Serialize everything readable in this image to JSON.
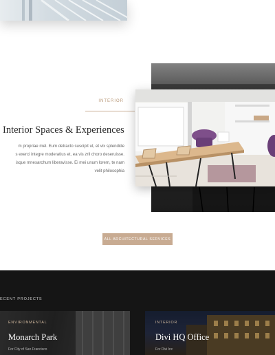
{
  "interior": {
    "eyebrow": "INTERIOR",
    "heading": "Interior Spaces & Experiences",
    "body_lines": [
      "m propriae mel. Eum detracto suscipit ut, et vix splendide",
      "s exerci integre moderatius et, ea vis zril choro deseruisse.",
      "isque mnesarchum liberavisse. Ei mei unum lorem, te nam",
      "velit philosophia"
    ]
  },
  "cta": {
    "label": "ALL ARCHITECTURAL SERVICES"
  },
  "projects": {
    "title": "ECENT PROJECTS",
    "cards": [
      {
        "category": "ENVIRONMENTAL",
        "title": "Monarch Park",
        "subtitle": "For City of San Francisco"
      },
      {
        "category": "INTERIOR",
        "title": "Divi HQ Office",
        "subtitle": "For Divi Inc"
      }
    ]
  },
  "colors": {
    "accent": "#c8ab92",
    "eyebrow_text": "#b89878",
    "dark_section": "#151515"
  }
}
